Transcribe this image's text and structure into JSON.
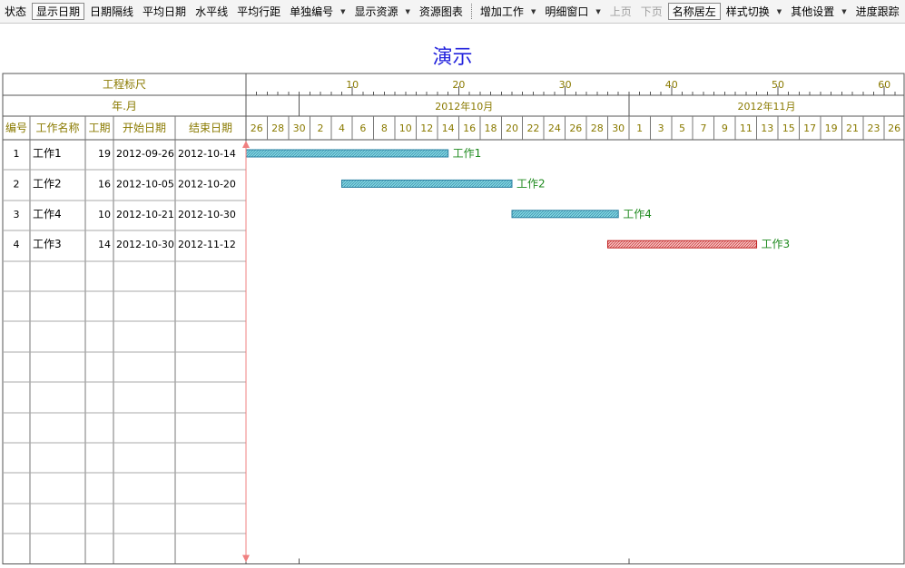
{
  "toolbar": {
    "items": [
      {
        "label": "状态",
        "dropdown": false,
        "pressed": false,
        "disabled": false
      },
      {
        "label": "显示日期",
        "dropdown": false,
        "pressed": true,
        "disabled": false
      },
      {
        "label": "日期隔线",
        "dropdown": false,
        "pressed": false,
        "disabled": false
      },
      {
        "label": "平均日期",
        "dropdown": false,
        "pressed": false,
        "disabled": false
      },
      {
        "label": "水平线",
        "dropdown": false,
        "pressed": false,
        "disabled": false
      },
      {
        "label": "平均行距",
        "dropdown": false,
        "pressed": false,
        "disabled": false
      },
      {
        "label": "单独编号",
        "dropdown": true,
        "pressed": false,
        "disabled": false
      },
      {
        "label": "显示资源",
        "dropdown": true,
        "pressed": false,
        "disabled": false
      },
      {
        "label": "资源图表",
        "dropdown": false,
        "pressed": false,
        "disabled": false
      },
      {
        "separator": true
      },
      {
        "label": "增加工作",
        "dropdown": true,
        "pressed": false,
        "disabled": false
      },
      {
        "label": "明细窗口",
        "dropdown": true,
        "pressed": false,
        "disabled": false
      },
      {
        "label": "上页",
        "dropdown": false,
        "pressed": false,
        "disabled": true
      },
      {
        "label": "下页",
        "dropdown": false,
        "pressed": false,
        "disabled": true
      },
      {
        "label": "名称居左",
        "dropdown": false,
        "pressed": true,
        "disabled": false
      },
      {
        "label": "样式切换",
        "dropdown": true,
        "pressed": false,
        "disabled": false
      },
      {
        "label": "其他设置",
        "dropdown": true,
        "pressed": false,
        "disabled": false
      },
      {
        "label": "进度跟踪",
        "dropdown": true,
        "pressed": false,
        "disabled": false
      }
    ]
  },
  "chart": {
    "title": "演示",
    "scale_label": "工程标尺",
    "yearmonth_label": "年.月",
    "columns": [
      "编号",
      "工作名称",
      "工期",
      "开始日期",
      "结束日期"
    ],
    "ruler_ticks": [
      "10",
      "20",
      "30",
      "40",
      "50",
      "60"
    ],
    "months": [
      "2012年10月",
      "2012年11月"
    ],
    "day_labels": [
      "26",
      "28",
      "30",
      "2",
      "4",
      "6",
      "8",
      "10",
      "12",
      "14",
      "16",
      "18",
      "20",
      "22",
      "24",
      "26",
      "28",
      "30",
      "1",
      "3",
      "5",
      "7",
      "9",
      "11",
      "13",
      "15",
      "17",
      "19",
      "21",
      "23",
      "26"
    ],
    "tasks": [
      {
        "id": "1",
        "name": "工作1",
        "duration": "19",
        "start": "2012-09-26",
        "end": "2012-10-14",
        "bar_label": "工作1",
        "color": "blue"
      },
      {
        "id": "2",
        "name": "工作2",
        "duration": "16",
        "start": "2012-10-05",
        "end": "2012-10-20",
        "bar_label": "工作2",
        "color": "blue"
      },
      {
        "id": "3",
        "name": "工作4",
        "duration": "10",
        "start": "2012-10-21",
        "end": "2012-10-30",
        "bar_label": "工作4",
        "color": "blue"
      },
      {
        "id": "4",
        "name": "工作3",
        "duration": "14",
        "start": "2012-10-30",
        "end": "2012-11-12",
        "bar_label": "工作3",
        "color": "red"
      }
    ],
    "empty_rows": 10,
    "colors": {
      "header_text": "#8a7a00",
      "bar_label": "#1f8a1f",
      "title": "#2222dd",
      "bar_blue": "#7fd3df",
      "bar_blue_border": "#2a7fa0",
      "bar_red": "#f4b8b8",
      "bar_red_border": "#c02020",
      "today_line": "#f08080"
    }
  }
}
